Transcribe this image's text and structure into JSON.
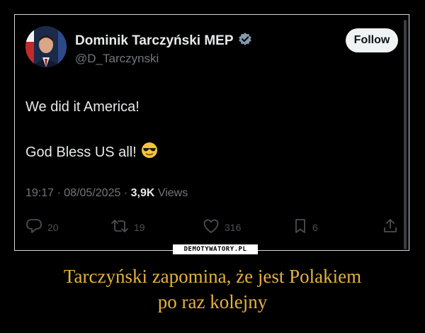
{
  "tweet": {
    "author_name": "Dominik Tarczyński MEP",
    "handle": "@D_Tarczynski",
    "follow_label": "Follow",
    "line1": "We did it America!",
    "line2": "God Bless US all!",
    "time": "19:17",
    "date": "08/05/2025",
    "views_count": "3,9K",
    "views_label": "Views",
    "replies": "20",
    "reposts": "19",
    "likes": "316",
    "bookmarks": "6"
  },
  "watermark": "DEMOTYWATORY.PL",
  "caption": {
    "line1": "Tarczyński zapomina, że jest Polakiem",
    "line2": "po raz kolejny"
  },
  "colors": {
    "background": "#000000",
    "caption": "#e6b13d",
    "verified": "#829aab",
    "text": "#e7e9ea",
    "muted": "#71767b"
  },
  "icons": [
    "verified-badge-icon",
    "sunglasses-emoji-icon",
    "reply-icon",
    "repost-icon",
    "like-icon",
    "bookmark-icon",
    "share-icon"
  ]
}
